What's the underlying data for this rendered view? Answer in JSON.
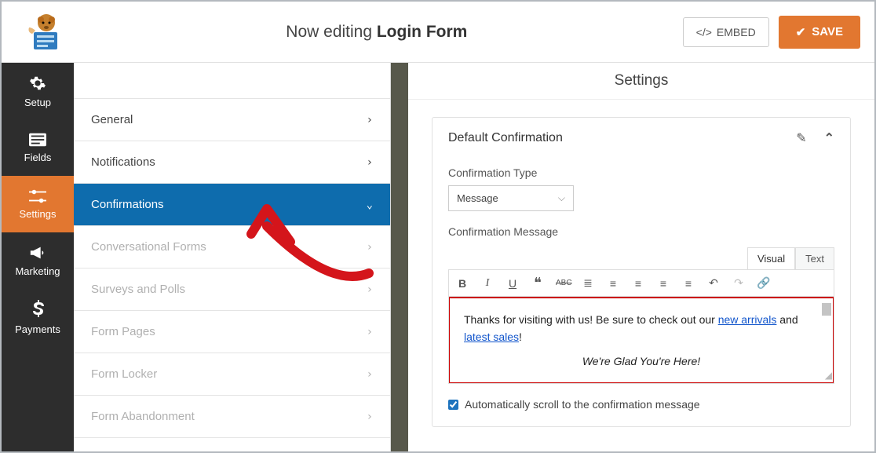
{
  "header": {
    "editing_prefix": "Now editing ",
    "form_name": "Login Form",
    "embed_label": "EMBED",
    "save_label": "SAVE"
  },
  "sidenav": [
    {
      "label": "Setup"
    },
    {
      "label": "Fields"
    },
    {
      "label": "Settings"
    },
    {
      "label": "Marketing"
    },
    {
      "label": "Payments"
    }
  ],
  "sublist": [
    {
      "label": "General",
      "state": "normal"
    },
    {
      "label": "Notifications",
      "state": "normal"
    },
    {
      "label": "Confirmations",
      "state": "active"
    },
    {
      "label": "Conversational Forms",
      "state": "disabled"
    },
    {
      "label": "Surveys and Polls",
      "state": "disabled"
    },
    {
      "label": "Form Pages",
      "state": "disabled"
    },
    {
      "label": "Form Locker",
      "state": "disabled"
    },
    {
      "label": "Form Abandonment",
      "state": "disabled"
    }
  ],
  "content": {
    "page_title": "Settings",
    "panel_title": "Default Confirmation",
    "type_label": "Confirmation Type",
    "type_value": "Message",
    "message_label": "Confirmation Message",
    "tabs": {
      "visual": "Visual",
      "text": "Text"
    },
    "message": {
      "line1_a": "Thanks for visiting with us! Be sure to check out our ",
      "link1": "new arrivals",
      "line1_b": " and",
      "link2": " latest sales",
      "line1_c": "!",
      "line2": "We're Glad You're Here!"
    },
    "autoscroll_label": "Automatically scroll to the confirmation message",
    "autoscroll_checked": true
  }
}
